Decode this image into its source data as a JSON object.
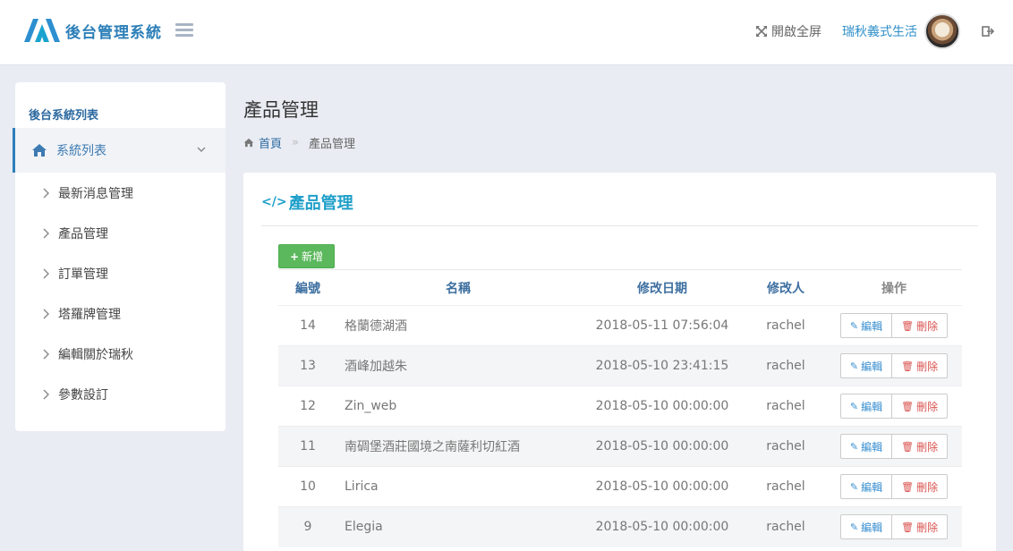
{
  "header": {
    "app_title": "後台管理系統",
    "fullscreen_label": "開啟全屏",
    "username": "瑞秋義式生活"
  },
  "sidebar": {
    "section_title": "後台系統列表",
    "group_label": "系統列表",
    "items": [
      {
        "label": "最新消息管理"
      },
      {
        "label": "產品管理"
      },
      {
        "label": "訂單管理"
      },
      {
        "label": "塔羅牌管理"
      },
      {
        "label": "編輯關於瑞秋"
      },
      {
        "label": "參數設訂"
      }
    ]
  },
  "main": {
    "page_title": "產品管理",
    "breadcrumb": {
      "home": "首頁",
      "separator": "»",
      "current": "產品管理"
    },
    "panel_title": "產品管理",
    "add_label": "新增",
    "table": {
      "headers": {
        "id": "編號",
        "name": "名稱",
        "date": "修改日期",
        "user": "修改人",
        "ops": "操作"
      },
      "edit_label": "編輯",
      "delete_label": "刪除",
      "rows": [
        {
          "id": "14",
          "name": "格蘭德湖酒",
          "date": "2018-05-11 07:56:04",
          "user": "rachel"
        },
        {
          "id": "13",
          "name": "酒峰加越朱",
          "date": "2018-05-10 23:41:15",
          "user": "rachel"
        },
        {
          "id": "12",
          "name": "Zin_web",
          "date": "2018-05-10 00:00:00",
          "user": "rachel"
        },
        {
          "id": "11",
          "name": "南碉堡酒莊國境之南薩利切紅酒",
          "date": "2018-05-10 00:00:00",
          "user": "rachel"
        },
        {
          "id": "10",
          "name": "Lirica",
          "date": "2018-05-10 00:00:00",
          "user": "rachel"
        },
        {
          "id": "9",
          "name": "Elegia",
          "date": "2018-05-10 00:00:00",
          "user": "rachel"
        }
      ]
    }
  },
  "colors": {
    "brand": "#2c7fb8",
    "accent": "#1e9fc9",
    "success": "#5cb85c",
    "danger": "#d9534f"
  }
}
